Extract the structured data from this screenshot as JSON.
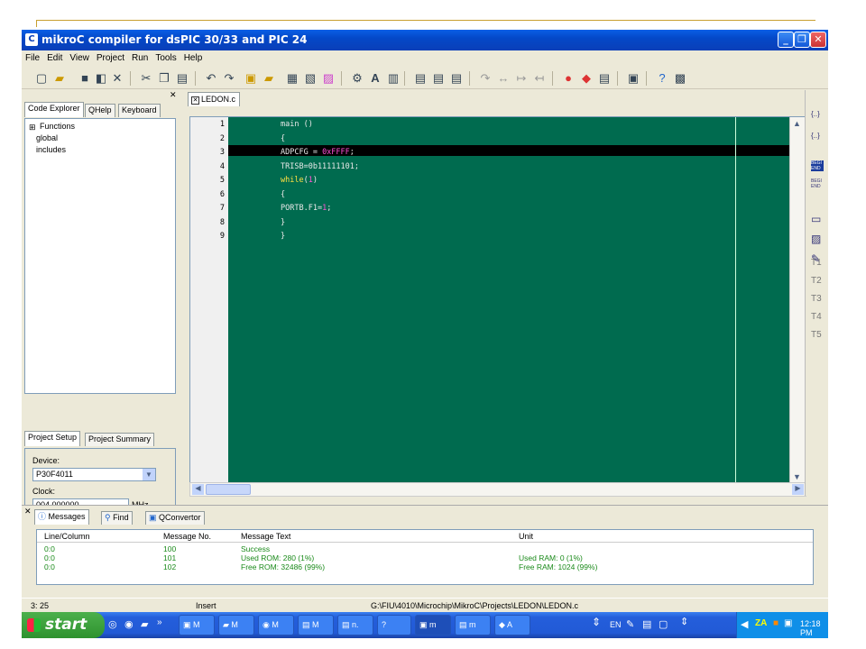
{
  "window": {
    "title": "mikroC compiler for dsPIC 30/33 and PIC 24",
    "minimize": "_",
    "maximize": "❐",
    "close": "✕"
  },
  "menu": [
    "File",
    "Edit",
    "View",
    "Project",
    "Run",
    "Tools",
    "Help"
  ],
  "left_tabs": {
    "code_explorer": "Code Explorer",
    "qhelp": "QHelp",
    "keyboard": "Keyboard"
  },
  "tree": {
    "functions": "Functions",
    "global": "global",
    "includes": "includes",
    "expander": "⊞"
  },
  "project_tabs": {
    "setup": "Project Setup",
    "summary": "Project Summary"
  },
  "project": {
    "device_label": "Device:",
    "device": "P30F4011",
    "clock_label": "Clock:",
    "clock": "004.000000",
    "clock_unit": "MHz"
  },
  "editor": {
    "tab": "LEDON.c",
    "tab_close": "✕"
  },
  "code_lines": [
    {
      "n": "1",
      "text": "main ()"
    },
    {
      "n": "2",
      "text": "{"
    },
    {
      "n": "3",
      "text": "ADPCFG = ",
      "lit": "0xFFFF",
      "tail": ";"
    },
    {
      "n": "4",
      "text": "TRISB=0b11111101;"
    },
    {
      "n": "5",
      "kw": "while",
      "text": "(",
      "lit": "1",
      "tail": ")"
    },
    {
      "n": "6",
      "text": "{"
    },
    {
      "n": "7",
      "text": "PORTB.F1=",
      "lit": "1",
      "tail": ";"
    },
    {
      "n": "8",
      "text": "}"
    },
    {
      "n": "9",
      "text": "}"
    }
  ],
  "right_strip": [
    "{..}",
    "{..}",
    "BEGI END",
    "BEGI END",
    "T1",
    "T2",
    "T3",
    "T4",
    "T5"
  ],
  "msg_tabs": {
    "messages": "Messages",
    "find": "Find",
    "qconvertor": "QConvertor"
  },
  "msg_headers": {
    "line": "Line/Column",
    "no": "Message No.",
    "text": "Message Text",
    "unit": "Unit"
  },
  "messages": [
    {
      "line": "0:0",
      "no": "100",
      "text": "Success",
      "unit": ""
    },
    {
      "line": "0:0",
      "no": "101",
      "text": "Used ROM: 280  (1%)",
      "unit": "Used RAM: 0  (1%)"
    },
    {
      "line": "0:0",
      "no": "102",
      "text": "Free ROM: 32486  (99%)",
      "unit": "Free RAM: 1024  (99%)"
    }
  ],
  "status": {
    "pos": "3: 25",
    "mode": "Insert",
    "path": "G:\\FIU\\4010\\Microchip\\MikroC\\Projects\\LEDON\\LEDON.c"
  },
  "taskbar": {
    "start": "start",
    "tasks": [
      "M",
      "M",
      "M",
      "M",
      "n.",
      "",
      "m",
      "m",
      "A"
    ],
    "lang": "EN",
    "clock": "12:18 PM"
  },
  "colors": {
    "editor_bg": "#006b4f",
    "keyword": "#ffe040",
    "literal": "#ff4fd6",
    "highlight": "#000000"
  }
}
